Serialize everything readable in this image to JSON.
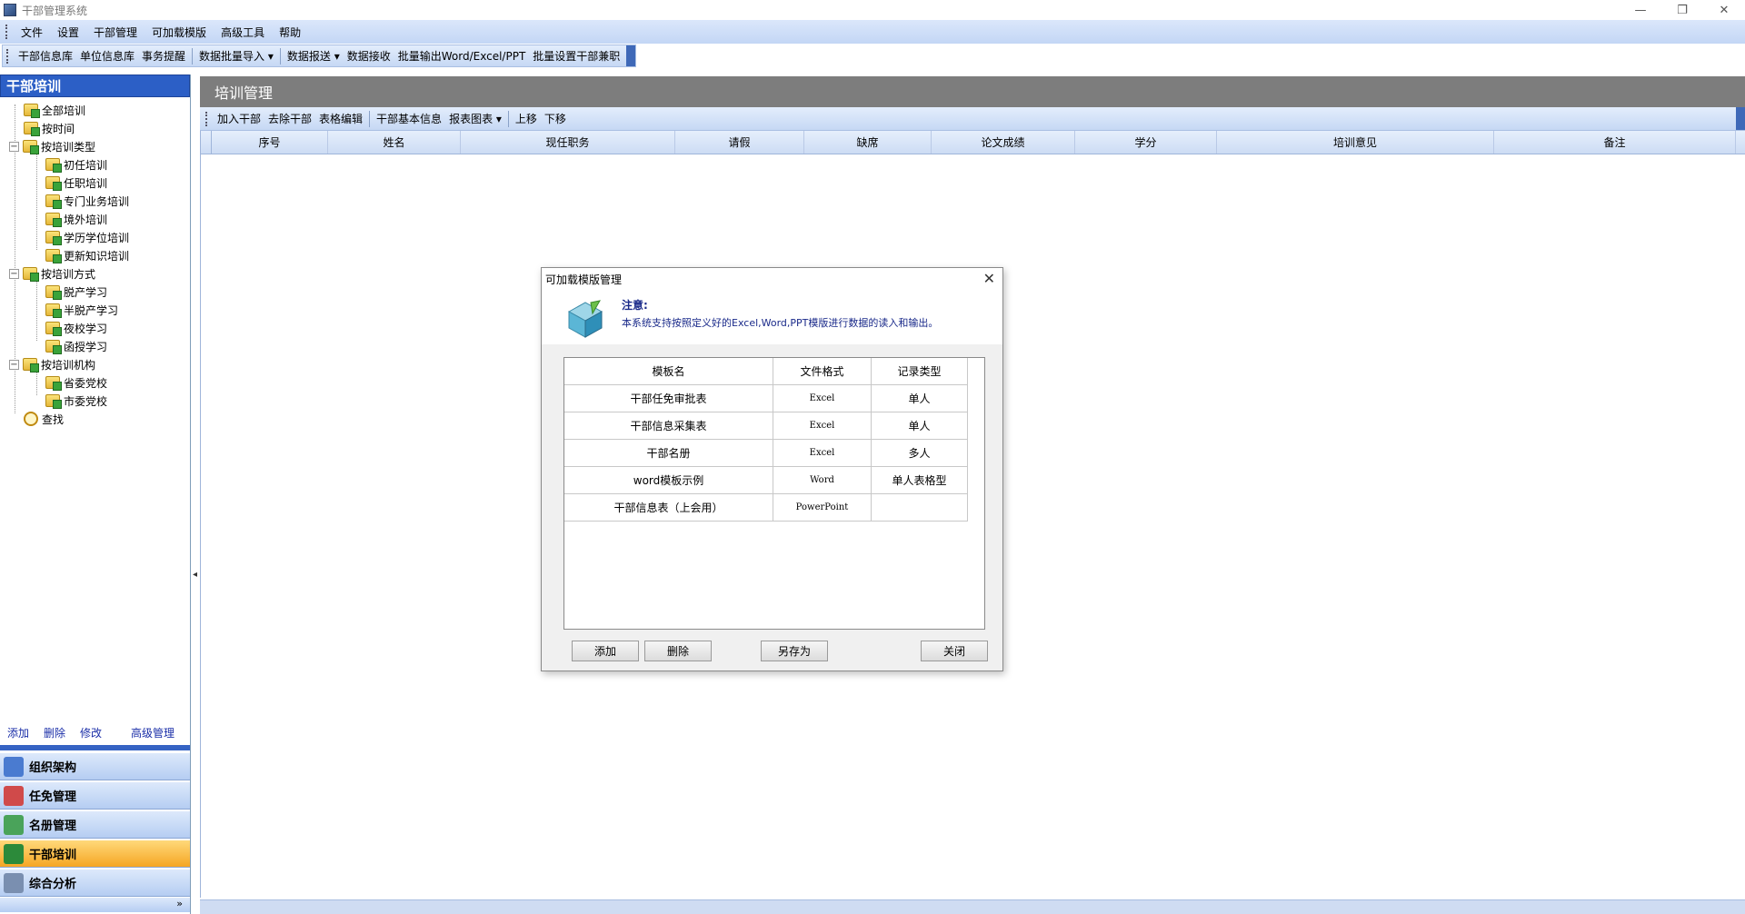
{
  "window": {
    "title": "干部管理系统",
    "controls": [
      "—",
      "❐",
      "✕"
    ]
  },
  "menubar": [
    "文件",
    "设置",
    "干部管理",
    "可加载模版",
    "高级工具",
    "帮助"
  ],
  "toolbar": {
    "group1": [
      "干部信息库",
      "单位信息库",
      "事务提醒"
    ],
    "group2": [
      "数据批量导入 ▾"
    ],
    "group3": [
      "数据报送 ▾",
      "数据接收",
      "批量输出Word/Excel/PPT",
      "批量设置干部兼职"
    ]
  },
  "left": {
    "header": "干部培训",
    "tree": [
      {
        "label": "全部培训",
        "level": 1
      },
      {
        "label": "按时间",
        "level": 1
      },
      {
        "label": "按培训类型",
        "level": 1,
        "expander": "−"
      },
      {
        "label": "初任培训",
        "level": 2
      },
      {
        "label": "任职培训",
        "level": 2
      },
      {
        "label": "专门业务培训",
        "level": 2
      },
      {
        "label": "境外培训",
        "level": 2
      },
      {
        "label": "学历学位培训",
        "level": 2
      },
      {
        "label": "更新知识培训",
        "level": 2
      },
      {
        "label": "按培训方式",
        "level": 1,
        "expander": "−"
      },
      {
        "label": "脱产学习",
        "level": 2
      },
      {
        "label": "半脱产学习",
        "level": 2
      },
      {
        "label": "夜校学习",
        "level": 2
      },
      {
        "label": "函授学习",
        "level": 2
      },
      {
        "label": "按培训机构",
        "level": 1,
        "expander": "−"
      },
      {
        "label": "省委党校",
        "level": 2
      },
      {
        "label": "市委党校",
        "level": 2
      },
      {
        "label": "查找",
        "level": 1,
        "icon": "search"
      }
    ],
    "actions": [
      "添加",
      "删除",
      "修改",
      "高级管理"
    ],
    "nav": [
      "组织架构",
      "任免管理",
      "名册管理",
      "干部培训",
      "综合分析"
    ],
    "nav_more": "»"
  },
  "right": {
    "header": "培训管理",
    "toolbar1": [
      "加入干部",
      "去除干部",
      "表格编辑"
    ],
    "toolbar2": [
      "干部基本信息",
      "报表图表 ▾"
    ],
    "toolbar3": [
      "上移",
      "下移"
    ],
    "columns": [
      "序号",
      "姓名",
      "现任职务",
      "请假",
      "缺席",
      "论文成绩",
      "学分",
      "培训意见",
      "备注"
    ]
  },
  "dialog": {
    "title": "可加载模版管理",
    "notice_title": "注意:",
    "notice_text": "本系统支持按照定义好的Excel,Word,PPT模版进行数据的读入和输出。",
    "columns": [
      "模板名",
      "文件格式",
      "记录类型"
    ],
    "rows": [
      [
        "干部任免审批表",
        "Excel",
        "单人"
      ],
      [
        "干部信息采集表",
        "Excel",
        "单人"
      ],
      [
        "干部名册",
        "Excel",
        "多人"
      ],
      [
        "word模板示例",
        "Word",
        "单人表格型"
      ],
      [
        "干部信息表（上会用）",
        "PowerPoint",
        ""
      ]
    ],
    "buttons": {
      "add": "添加",
      "delete": "删除",
      "save_as": "另存为",
      "close": "关闭"
    }
  }
}
